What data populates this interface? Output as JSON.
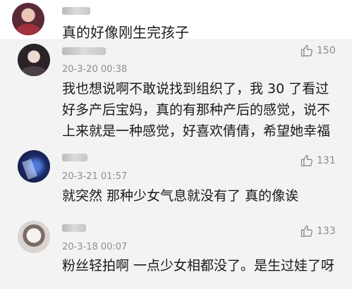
{
  "top_comment": {
    "text": "真的好像刚生完孩子"
  },
  "comments": [
    {
      "date": "20-3-20 00:38",
      "likes": "150",
      "text": "我也想说啊不敢说找到组织了，我 30 了看过\n好多产后宝妈，真的有那种产后的感觉，说不\n上来就是一种感觉，好喜欢倩倩，希望她幸福"
    },
    {
      "date": "20-3-21 01:57",
      "likes": "131",
      "text": "就突然 那种少女气息就没有了 真的像诶"
    },
    {
      "date": "20-3-18 00:07",
      "likes": "133",
      "text": "粉丝轻拍啊 一点少女相都没了。是生过娃了呀"
    }
  ],
  "icons": {
    "like": "thumbs-up-icon"
  }
}
